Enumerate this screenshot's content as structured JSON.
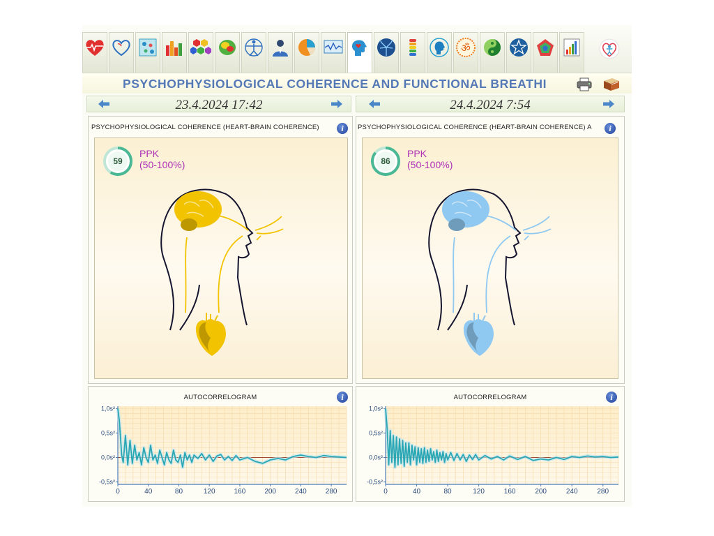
{
  "toolbar": {
    "buttons": [
      {
        "icon": "heart-ecg-icon"
      },
      {
        "icon": "heart-outline-icon"
      },
      {
        "icon": "cells-icon"
      },
      {
        "icon": "bar-chart-icon"
      },
      {
        "icon": "hexagons-icon"
      },
      {
        "icon": "brain-map-icon"
      },
      {
        "icon": "vitruvian-icon"
      },
      {
        "icon": "doctor-icon"
      },
      {
        "icon": "pie-chart-icon"
      },
      {
        "icon": "monitor-wave-icon"
      },
      {
        "icon": "head-heart-icon"
      },
      {
        "icon": "neural-tree-icon"
      },
      {
        "icon": "spine-icon"
      },
      {
        "icon": "face-profile-icon"
      },
      {
        "icon": "om-icon"
      },
      {
        "icon": "yin-yang-icon"
      },
      {
        "icon": "star-circle-icon"
      },
      {
        "icon": "pentagon-icon"
      },
      {
        "icon": "small-bar-chart-icon"
      },
      {
        "icon": "heart-person-icon"
      }
    ],
    "active_index": 10
  },
  "header": {
    "title": "PSYCHOPHYSIOLOGICAL COHERENCE AND FUNCTIONAL BREATHI"
  },
  "sessions": [
    {
      "date": "23.4.2024 17:42",
      "coherence_panel": {
        "title": "PSYCHOPHYSIOLOGICAL COHERENCE (HEART-BRAIN COHERENCE)",
        "score": "59",
        "score_fraction": 0.59,
        "metric_label": "PPK",
        "metric_range": "(50-100%)",
        "theme_color": "#f2c300"
      },
      "autocorrelogram": {
        "title": "AUTOCORRELOGRAM"
      }
    },
    {
      "date": "24.4.2024 7:54",
      "coherence_panel": {
        "title": "PSYCHOPHYSIOLOGICAL COHERENCE (HEART-BRAIN COHERENCE) A",
        "score": "86",
        "score_fraction": 0.86,
        "metric_label": "PPK",
        "metric_range": "(50-100%)",
        "theme_color": "#8fc8f0"
      },
      "autocorrelogram": {
        "title": "AUTOCORRELOGRAM"
      }
    }
  ],
  "chart_data": [
    {
      "type": "line",
      "title": "AUTOCORRELOGRAM",
      "xlim": [
        0,
        300
      ],
      "ylim": [
        -0.55,
        1.05
      ],
      "xticks": [
        0,
        40,
        80,
        120,
        160,
        200,
        240,
        280
      ],
      "yticks": [
        {
          "v": 1.0,
          "label": "1,0s²"
        },
        {
          "v": 0.5,
          "label": "0,5s²"
        },
        {
          "v": 0.0,
          "label": "0,0s²"
        },
        {
          "v": -0.5,
          "label": "-0,5s²"
        }
      ],
      "series": [
        {
          "color": "#2aa7b4",
          "x": [
            0,
            2,
            5,
            7,
            10,
            13,
            16,
            19,
            22,
            25,
            28,
            31,
            34,
            37,
            40,
            43,
            46,
            49,
            52,
            55,
            58,
            61,
            64,
            67,
            70,
            73,
            76,
            79,
            82,
            85,
            88,
            91,
            94,
            97,
            100,
            105,
            110,
            115,
            120,
            125,
            130,
            135,
            140,
            145,
            150,
            155,
            160,
            170,
            180,
            190,
            200,
            210,
            220,
            230,
            240,
            250,
            260,
            270,
            280,
            290,
            300
          ],
          "y": [
            1.0,
            0.75,
            0.05,
            -0.1,
            0.45,
            -0.15,
            0.35,
            -0.12,
            0.25,
            -0.05,
            0.1,
            -0.15,
            0.2,
            0.0,
            -0.1,
            0.25,
            -0.05,
            0.05,
            -0.12,
            0.15,
            0.0,
            -0.15,
            0.1,
            -0.05,
            -0.12,
            0.15,
            -0.05,
            -0.1,
            0.05,
            -0.2,
            0.1,
            -0.05,
            0.05,
            -0.1,
            0.05,
            -0.02,
            0.08,
            -0.05,
            0.05,
            -0.08,
            0.03,
            0.06,
            -0.05,
            0.02,
            -0.06,
            0.04,
            -0.05,
            0.0,
            -0.08,
            -0.12,
            -0.05,
            -0.02,
            -0.05,
            0.02,
            0.05,
            0.02,
            0.0,
            0.04,
            0.02,
            0.01,
            0.0
          ]
        }
      ]
    },
    {
      "type": "line",
      "title": "AUTOCORRELOGRAM",
      "xlim": [
        0,
        300
      ],
      "ylim": [
        -0.55,
        1.05
      ],
      "xticks": [
        0,
        40,
        80,
        120,
        160,
        200,
        240,
        280
      ],
      "yticks": [
        {
          "v": 1.0,
          "label": "1,0s²"
        },
        {
          "v": 0.5,
          "label": "0,5s²"
        },
        {
          "v": 0.0,
          "label": "0,0s²"
        },
        {
          "v": -0.5,
          "label": "-0,5s²"
        }
      ],
      "series": [
        {
          "color": "#2aa7b4",
          "x": [
            0,
            2,
            4,
            6,
            8,
            10,
            12,
            14,
            16,
            18,
            20,
            22,
            24,
            26,
            28,
            30,
            32,
            34,
            36,
            38,
            40,
            42,
            44,
            46,
            48,
            50,
            52,
            54,
            56,
            58,
            60,
            62,
            64,
            66,
            68,
            70,
            72,
            74,
            76,
            78,
            80,
            84,
            88,
            92,
            96,
            100,
            104,
            108,
            112,
            116,
            120,
            128,
            136,
            144,
            152,
            160,
            170,
            180,
            190,
            200,
            210,
            220,
            230,
            240,
            250,
            260,
            270,
            280,
            290,
            300
          ],
          "y": [
            1.0,
            0.6,
            -0.15,
            0.55,
            -0.1,
            0.45,
            -0.2,
            0.42,
            -0.15,
            0.38,
            -0.12,
            0.35,
            -0.18,
            0.3,
            -0.1,
            0.3,
            -0.15,
            0.25,
            -0.05,
            0.22,
            -0.15,
            0.2,
            -0.1,
            0.18,
            -0.12,
            0.2,
            -0.1,
            0.15,
            -0.08,
            0.18,
            -0.05,
            0.12,
            -0.1,
            0.15,
            -0.08,
            0.1,
            -0.05,
            0.12,
            -0.1,
            0.08,
            -0.05,
            0.1,
            -0.06,
            0.08,
            -0.05,
            0.06,
            -0.08,
            0.05,
            -0.04,
            0.06,
            -0.05,
            0.04,
            -0.03,
            0.02,
            -0.05,
            0.03,
            -0.04,
            0.02,
            -0.06,
            -0.03,
            -0.05,
            0.0,
            -0.04,
            0.02,
            0.0,
            0.03,
            0.01,
            0.02,
            0.0,
            0.01
          ]
        }
      ]
    }
  ]
}
